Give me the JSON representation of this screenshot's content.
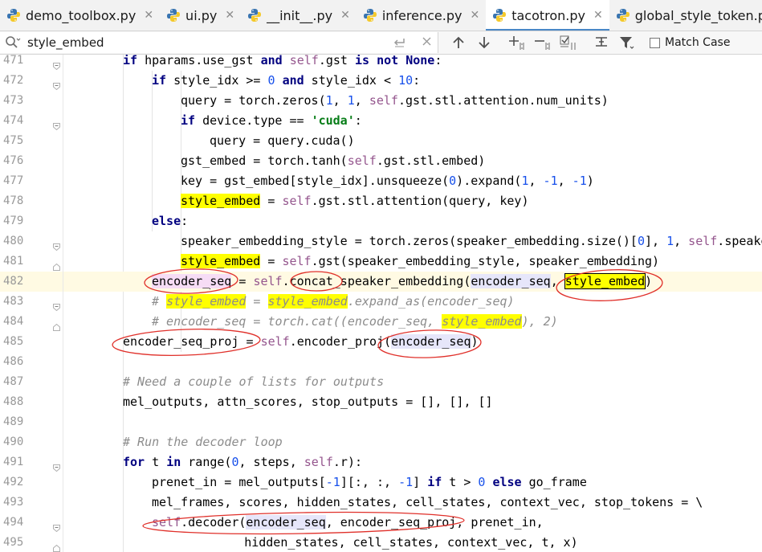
{
  "tabs": [
    {
      "label": "demo_toolbox.py",
      "active": false
    },
    {
      "label": "ui.py",
      "active": false
    },
    {
      "label": "__init__.py",
      "active": false
    },
    {
      "label": "inference.py",
      "active": false
    },
    {
      "label": "tacotron.py",
      "active": true
    },
    {
      "label": "global_style_token.py",
      "active": false
    }
  ],
  "search": {
    "value": "style_embed",
    "match_case_label": "Match Case"
  },
  "icons": {
    "search": "search-icon",
    "clear_history": "return-icon",
    "close": "close-icon",
    "prev": "arrow-up-icon",
    "next": "arrow-down-icon",
    "add_occurrence": "add-selection-icon",
    "remove_occurrence": "remove-selection-icon",
    "select_all": "select-all-occurrences-icon",
    "in_selection": "search-in-selection-icon",
    "filter": "filter-icon"
  },
  "colors": {
    "keyword": "#000080",
    "self": "#94558d",
    "number": "#1750eb",
    "string": "#067d17",
    "comment": "#8c8c8c",
    "search_highlight": "#ffff00",
    "annotation": "#e0302a"
  },
  "editor": {
    "caret_line": 482,
    "lines": [
      {
        "n": "471",
        "indent": 2,
        "tokens": [
          [
            "kw",
            "if"
          ],
          [
            "t",
            " hparams.use_gst "
          ],
          [
            "kw",
            "and"
          ],
          [
            "t",
            " "
          ],
          [
            "slf",
            "self"
          ],
          [
            "t",
            ".gst "
          ],
          [
            "kw",
            "is not"
          ],
          [
            "t",
            " "
          ],
          [
            "kw",
            "None"
          ],
          [
            "t",
            ":"
          ]
        ]
      },
      {
        "n": "472",
        "indent": 3,
        "tokens": [
          [
            "kw",
            "if"
          ],
          [
            "t",
            " style_idx >= "
          ],
          [
            "num",
            "0"
          ],
          [
            "t",
            " "
          ],
          [
            "kw",
            "and"
          ],
          [
            "t",
            " style_idx < "
          ],
          [
            "num",
            "10"
          ],
          [
            "t",
            ":"
          ]
        ]
      },
      {
        "n": "473",
        "indent": 4,
        "tokens": [
          [
            "t",
            "query = torch.zeros("
          ],
          [
            "num",
            "1"
          ],
          [
            "t",
            ", "
          ],
          [
            "num",
            "1"
          ],
          [
            "t",
            ", "
          ],
          [
            "slf",
            "self"
          ],
          [
            "t",
            ".gst.stl.attention.num_units)"
          ]
        ]
      },
      {
        "n": "474",
        "indent": 4,
        "tokens": [
          [
            "kw",
            "if"
          ],
          [
            "t",
            " device.type == "
          ],
          [
            "str",
            "'cuda'"
          ],
          [
            "t",
            ":"
          ]
        ]
      },
      {
        "n": "475",
        "indent": 5,
        "tokens": [
          [
            "t",
            "query = query.cuda()"
          ]
        ]
      },
      {
        "n": "476",
        "indent": 4,
        "tokens": [
          [
            "t",
            "gst_embed = torch.tanh("
          ],
          [
            "slf",
            "self"
          ],
          [
            "t",
            ".gst.stl.embed)"
          ]
        ]
      },
      {
        "n": "477",
        "indent": 4,
        "tokens": [
          [
            "t",
            "key = gst_embed[style_idx].unsqueeze("
          ],
          [
            "num",
            "0"
          ],
          [
            "t",
            ").expand("
          ],
          [
            "num",
            "1"
          ],
          [
            "t",
            ", "
          ],
          [
            "num",
            "-1"
          ],
          [
            "t",
            ", "
          ],
          [
            "num",
            "-1"
          ],
          [
            "t",
            ")"
          ]
        ]
      },
      {
        "n": "478",
        "indent": 4,
        "tokens": [
          [
            "hl",
            "style_embed"
          ],
          [
            "t",
            " = "
          ],
          [
            "slf",
            "self"
          ],
          [
            "t",
            ".gst.stl.attention(query, key)"
          ]
        ]
      },
      {
        "n": "479",
        "indent": 3,
        "tokens": [
          [
            "kw",
            "else"
          ],
          [
            "t",
            ":"
          ]
        ]
      },
      {
        "n": "480",
        "indent": 4,
        "tokens": [
          [
            "t",
            "speaker_embedding_style = torch.zeros(speaker_embedding.size()["
          ],
          [
            "num",
            "0"
          ],
          [
            "t",
            "], "
          ],
          [
            "num",
            "1"
          ],
          [
            "t",
            ", "
          ],
          [
            "slf",
            "self"
          ],
          [
            "t",
            ".speaker_embedding.size()["
          ]
        ]
      },
      {
        "n": "481",
        "indent": 4,
        "tokens": [
          [
            "hl",
            "style_embed"
          ],
          [
            "t",
            " = "
          ],
          [
            "slf",
            "self"
          ],
          [
            "t",
            ".gst(speaker_embedding_style, speaker_embedding)"
          ]
        ]
      },
      {
        "n": "482",
        "indent": 3,
        "tokens": [
          [
            "refp",
            "encoder_"
          ],
          [
            "caret",
            ""
          ],
          [
            "refp",
            "seq"
          ],
          [
            "t",
            " = "
          ],
          [
            "slf",
            "self"
          ],
          [
            "t",
            ".concat_speaker_embedding("
          ],
          [
            "ref",
            "encoder_seq"
          ],
          [
            "t",
            ", "
          ],
          [
            "hlb",
            "style_embed"
          ],
          [
            "t",
            ")"
          ]
        ]
      },
      {
        "n": "483",
        "indent": 3,
        "tokens": [
          [
            "cm",
            "# "
          ],
          [
            "cmhl",
            "style_embed"
          ],
          [
            "cm",
            " = "
          ],
          [
            "cmhl",
            "style_embed"
          ],
          [
            "cm",
            ".expand_as(encoder_seq)"
          ]
        ]
      },
      {
        "n": "484",
        "indent": 3,
        "tokens": [
          [
            "cm",
            "# encoder_seq = torch.cat((encoder_seq, "
          ],
          [
            "cmhl",
            "style_embed"
          ],
          [
            "cm",
            "), 2)"
          ]
        ]
      },
      {
        "n": "485",
        "indent": 2,
        "tokens": [
          [
            "t",
            "encoder_seq_proj = "
          ],
          [
            "slf",
            "self"
          ],
          [
            "t",
            ".encoder_proj("
          ],
          [
            "ref",
            "encoder_seq"
          ],
          [
            "t",
            ")"
          ]
        ]
      },
      {
        "n": "486",
        "indent": 2,
        "tokens": []
      },
      {
        "n": "487",
        "indent": 2,
        "tokens": [
          [
            "cm",
            "# Need a couple of lists for outputs"
          ]
        ]
      },
      {
        "n": "488",
        "indent": 2,
        "tokens": [
          [
            "t",
            "mel_outputs, attn_scores, stop_outputs = [], [], []"
          ]
        ]
      },
      {
        "n": "489",
        "indent": 2,
        "tokens": []
      },
      {
        "n": "490",
        "indent": 2,
        "tokens": [
          [
            "cm",
            "# Run the decoder loop"
          ]
        ]
      },
      {
        "n": "491",
        "indent": 2,
        "tokens": [
          [
            "kw",
            "for"
          ],
          [
            "t",
            " t "
          ],
          [
            "kw",
            "in"
          ],
          [
            "t",
            " range("
          ],
          [
            "num",
            "0"
          ],
          [
            "t",
            ", steps, "
          ],
          [
            "slf",
            "self"
          ],
          [
            "t",
            ".r):"
          ]
        ]
      },
      {
        "n": "492",
        "indent": 3,
        "tokens": [
          [
            "t",
            "prenet_in = mel_outputs["
          ],
          [
            "num",
            "-1"
          ],
          [
            "t",
            "][:, :, "
          ],
          [
            "num",
            "-1"
          ],
          [
            "t",
            "] "
          ],
          [
            "kw",
            "if"
          ],
          [
            "t",
            " t > "
          ],
          [
            "num",
            "0"
          ],
          [
            "t",
            " "
          ],
          [
            "kw",
            "else"
          ],
          [
            "t",
            " go_frame"
          ]
        ]
      },
      {
        "n": "493",
        "indent": 3,
        "tokens": [
          [
            "t",
            "mel_frames, scores, hidden_states, cell_states, context_vec, stop_tokens = \\"
          ]
        ]
      },
      {
        "n": "494",
        "indent": 3,
        "tokens": [
          [
            "slf",
            "self"
          ],
          [
            "t",
            ".decoder("
          ],
          [
            "ref",
            "encoder_seq"
          ],
          [
            "t",
            ", encoder_seq_proj, prenet_in,"
          ]
        ]
      },
      {
        "n": "495",
        "indent": 6.2,
        "tokens": [
          [
            "t",
            "hidden_states, cell_states, context_vec, t, x)"
          ]
        ]
      }
    ]
  }
}
